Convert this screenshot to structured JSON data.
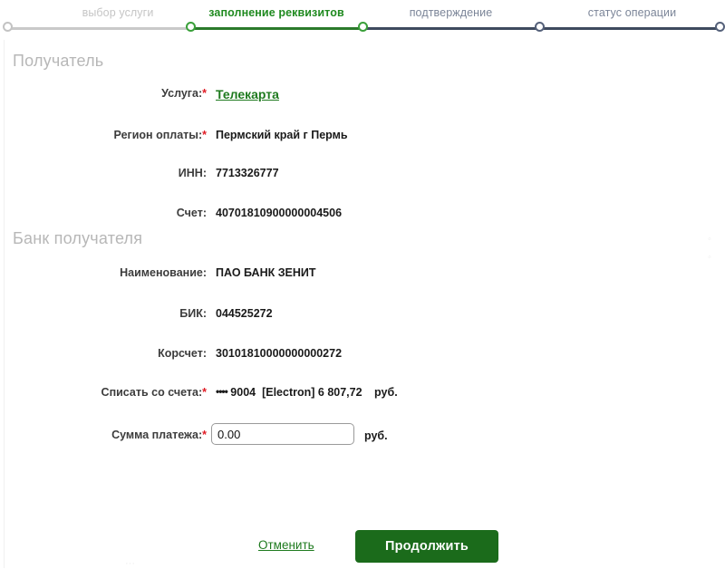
{
  "stepper": {
    "steps": [
      {
        "label": "выбор услуги",
        "state": "done"
      },
      {
        "label": "заполнение реквизитов",
        "state": "current"
      },
      {
        "label": "подтверждение",
        "state": "todo"
      },
      {
        "label": "статус операции",
        "state": "todo"
      }
    ],
    "colors": {
      "done_line": "#c9c9c9",
      "active_line": "#2b7a2b",
      "todo_line": "#3e4a5e",
      "active_text": "#1f8a1f",
      "muted_text": "#c5c5c5",
      "next_text": "#7b8598"
    }
  },
  "sections": {
    "recipient_title": "Получатель",
    "bank_title": "Банк получателя"
  },
  "fields": {
    "service": {
      "label": "Услуга:",
      "required": true,
      "value": "Телекарта"
    },
    "region": {
      "label": "Регион оплаты:",
      "required": true,
      "value": "Пермский край г Пермь"
    },
    "inn": {
      "label": "ИНН:",
      "required": false,
      "value": "7713326777"
    },
    "account": {
      "label": "Счет:",
      "required": false,
      "value": "40701810900000004506"
    },
    "bank_name": {
      "label": "Наименование:",
      "required": false,
      "value": "ПАО БАНК ЗЕНИТ"
    },
    "bik": {
      "label": "БИК:",
      "required": false,
      "value": "044525272"
    },
    "corr_account": {
      "label": "Корсчет:",
      "required": false,
      "value": "30101810000000000272"
    },
    "debit_from": {
      "label": "Списать со счета:",
      "required": true,
      "mask": "••••",
      "card_last4": "9004",
      "card_type": "[Electron]",
      "balance": "6 807,72",
      "currency": "руб."
    },
    "amount": {
      "label": "Сумма платежа:",
      "required": true,
      "value": "0.00",
      "placeholder": "0.00",
      "currency": "руб."
    }
  },
  "footer": {
    "cancel_label": "Отменить",
    "submit_label": "Продолжить",
    "submit_color": "#1b6b1b",
    "link_color": "#1e7a1e"
  }
}
